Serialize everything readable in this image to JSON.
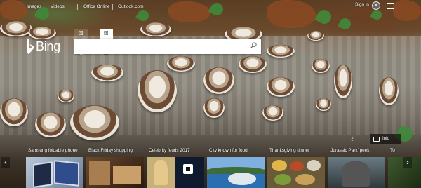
{
  "nav": {
    "images": "Images",
    "videos": "Videos",
    "office": "Office Online",
    "outlook": "Outlook.com",
    "signin": "Sign in"
  },
  "logo": {
    "text": "Bing"
  },
  "search": {
    "tabs": [
      "国内版",
      "国际版"
    ],
    "active_tab_index": 1,
    "value": "",
    "placeholder": ""
  },
  "info": {
    "label": "Info"
  },
  "carousel": {
    "cards": [
      {
        "title": "Samsung foldable phone"
      },
      {
        "title": "Black Friday shopping"
      },
      {
        "title": "Celebrity feuds 2017"
      },
      {
        "title": "City known for food"
      },
      {
        "title": "Thanksgiving dinner"
      },
      {
        "title": "'Jurassic Park' peek"
      },
      {
        "title": "To"
      }
    ]
  },
  "colors": {
    "bing_logo": "#ffffff",
    "accent": "#ffffff"
  }
}
